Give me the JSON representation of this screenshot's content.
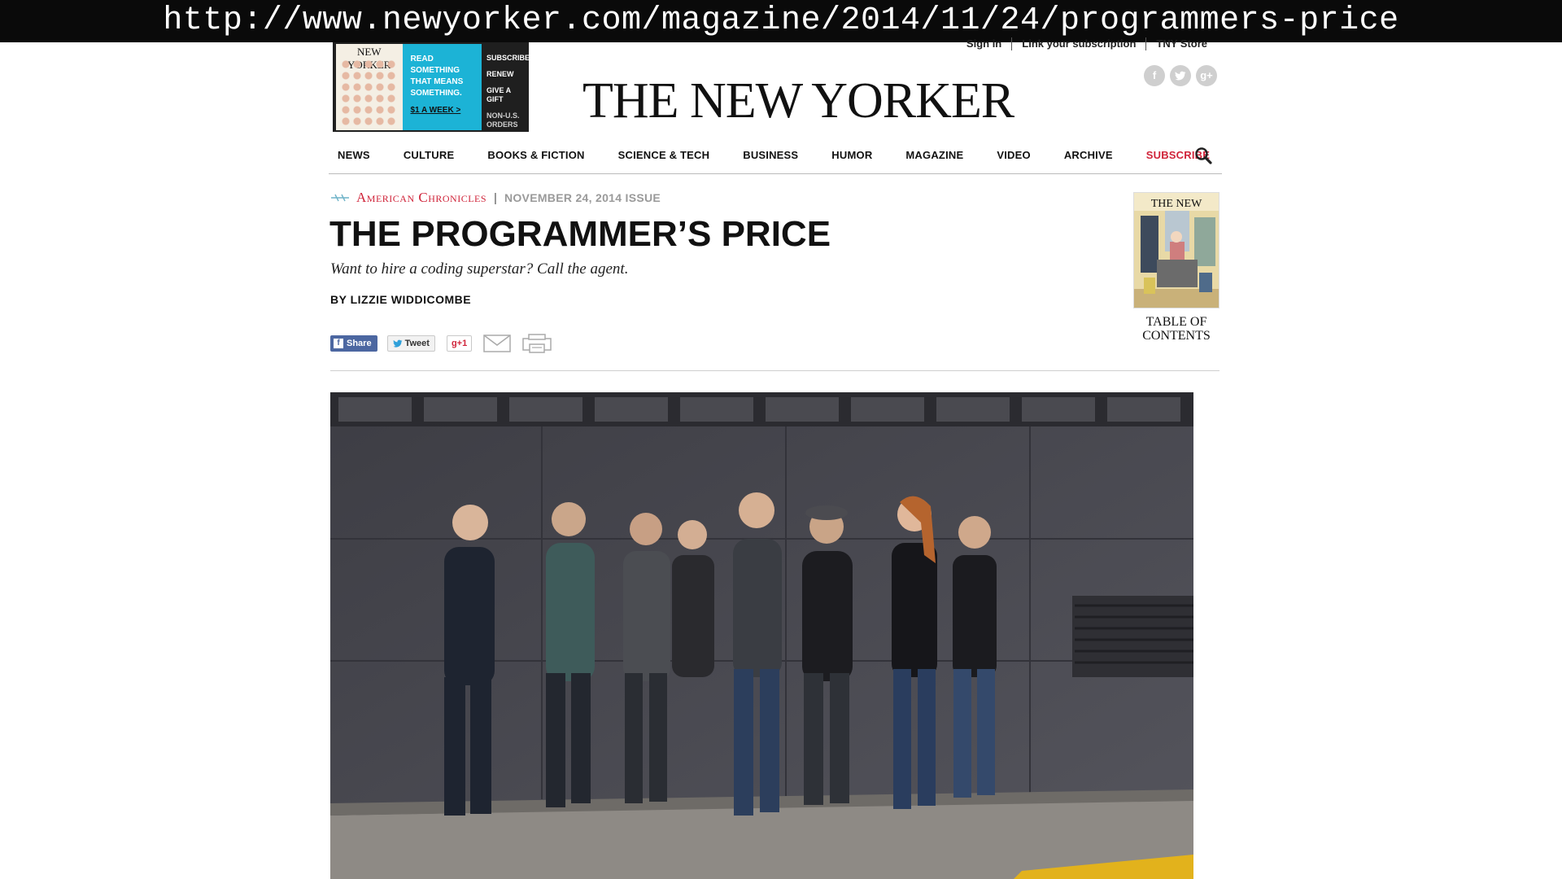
{
  "url_banner": "http://www.newyorker.com/magazine/2014/11/24/programmers-price",
  "utility_links": [
    "Sign in",
    "Link your subscription",
    "TNY Store"
  ],
  "ad": {
    "cover_title": "NEW YORKER",
    "tagline": [
      "READ",
      "SOMETHING",
      "THAT MEANS",
      "SOMETHING."
    ],
    "price": "$1 A WEEK >",
    "links": [
      "SUBSCRIBE",
      "RENEW",
      "GIVE A GIFT",
      "NON-U.S. ORDERS"
    ]
  },
  "masthead": "THE NEW YORKER",
  "social_icons": [
    "facebook-icon",
    "twitter-icon",
    "google-plus-icon"
  ],
  "nav": {
    "items": [
      "News",
      "Culture",
      "Books & Fiction",
      "Science & Tech",
      "Business",
      "Humor",
      "Magazine",
      "Video",
      "Archive"
    ],
    "subscribe": "Subscribe"
  },
  "article": {
    "department": "American Chronicles",
    "separator": "|",
    "issue": "November 24, 2014 Issue",
    "headline": "THE PROGRAMMER’S PRICE",
    "dek": "Want to hire a coding superstar? Call the agent.",
    "byline": "By Lizzie Widdicombe"
  },
  "share": {
    "facebook": "Share",
    "twitter": "Tweet",
    "google": "g+1"
  },
  "toc": {
    "cover_title": "THE NEW YORKER",
    "label_line1": "Table of",
    "label_line2": "Contents"
  },
  "colors": {
    "accent_red": "#d0243a",
    "ad_blue": "#1cb3d6",
    "facebook_blue": "#4c67a1"
  }
}
